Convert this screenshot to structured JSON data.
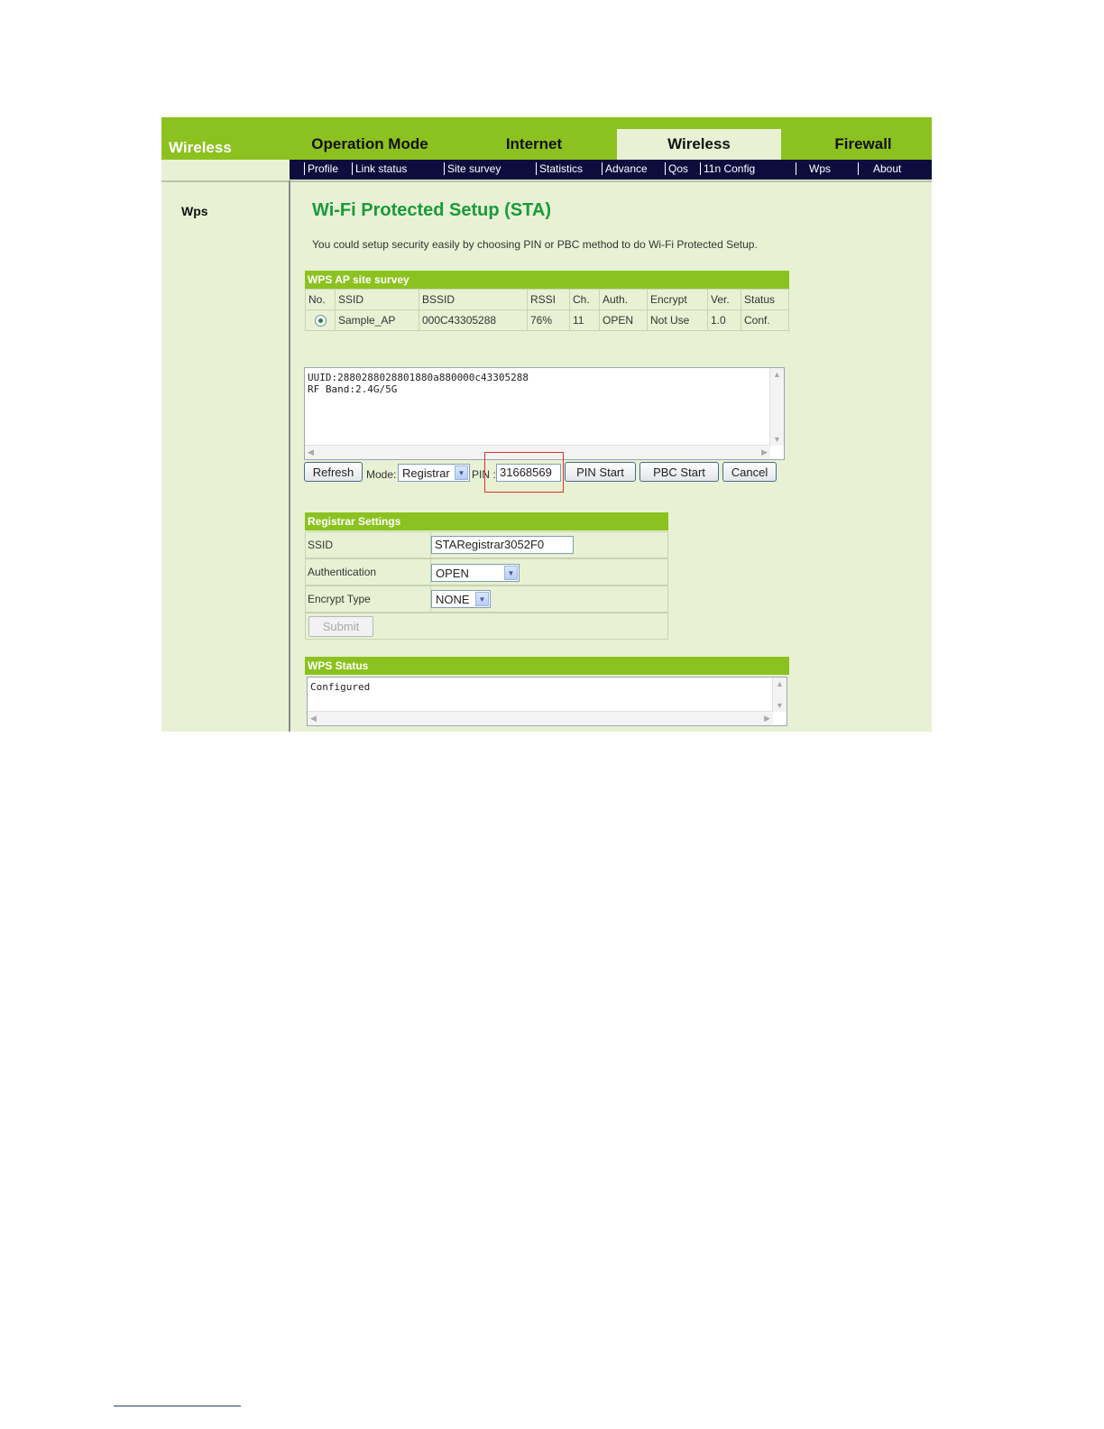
{
  "header": {
    "title": "Wireless",
    "tabs": [
      "Operation Mode",
      "Internet",
      "Wireless",
      "Firewall"
    ],
    "active_tab": "Wireless"
  },
  "subnav": [
    "Profile",
    "Link status",
    "Site survey",
    "Statistics",
    "Advance",
    "Qos",
    "11n Config",
    "Wps",
    "About"
  ],
  "sidebar": {
    "items": [
      "Wps"
    ]
  },
  "page": {
    "title": "Wi-Fi Protected Setup (STA)",
    "intro": "You could setup security easily by choosing PIN or PBC method to do Wi-Fi Protected Setup."
  },
  "survey": {
    "title": "WPS AP site survey",
    "columns": [
      "No.",
      "SSID",
      "BSSID",
      "RSSI",
      "Ch.",
      "Auth.",
      "Encrypt",
      "Ver.",
      "Status"
    ],
    "rows": [
      {
        "ssid": "Sample_AP",
        "bssid": "000C43305288",
        "rssi": "76%",
        "ch": "11",
        "auth": "OPEN",
        "encrypt": "Not Use",
        "ver": "1.0",
        "status": "Conf."
      }
    ]
  },
  "info_text": {
    "lines": [
      "UUID:28802880​28801880a880000c43305288",
      "RF Band:2.4G/5G"
    ]
  },
  "controls": {
    "refresh": "Refresh",
    "mode_label": "Mode:",
    "mode_value": "Registrar",
    "pin_label": "PIN :",
    "pin_value": "31668569",
    "pin_start": "PIN Start",
    "pbc_start": "PBC Start",
    "cancel": "Cancel"
  },
  "registrar": {
    "title": "Registrar Settings",
    "ssid_label": "SSID",
    "ssid_value": "STARegistrar3052F0",
    "auth_label": "Authentication",
    "auth_value": "OPEN",
    "encrypt_label": "Encrypt Type",
    "encrypt_value": "NONE",
    "submit": "Submit"
  },
  "status": {
    "title": "WPS Status",
    "text": "Configured"
  },
  "colors": {
    "accent_green": "#8cc21f",
    "title_green": "#1a9a3a",
    "nav_dark": "#0d0d3d",
    "panel_bg": "#e8f1d4",
    "highlight_red": "#d9342b"
  }
}
